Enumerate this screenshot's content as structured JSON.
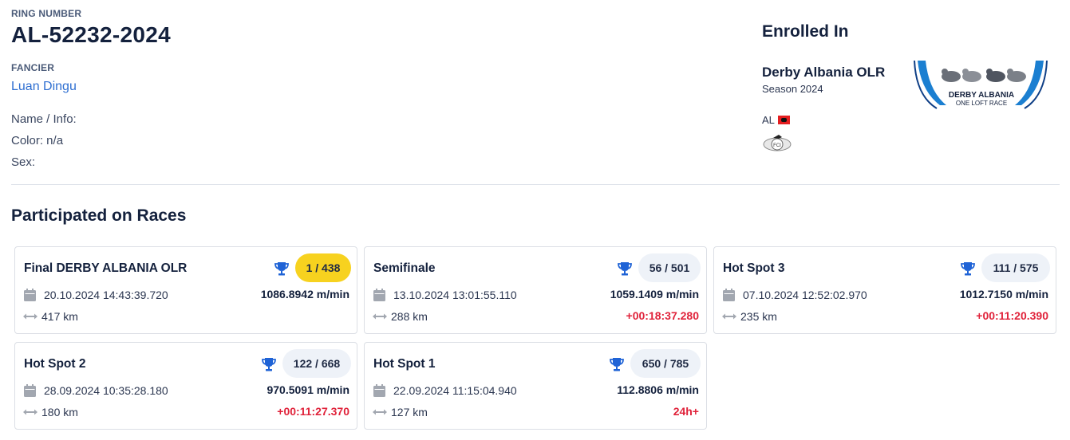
{
  "bird": {
    "ring_label": "RING NUMBER",
    "ring_number": "AL-52232-2024",
    "fancier_label": "FANCIER",
    "fancier_name": "Luan Dingu",
    "name_info": "Name / Info:",
    "color": "Color: n/a",
    "sex": "Sex:"
  },
  "enrollment": {
    "title": "Enrolled In",
    "competition": "Derby Albania OLR",
    "season": "Season 2024",
    "country": "AL",
    "logo_text_main": "DERBY ALBANIA",
    "logo_text_sub": "ONE LOFT RACE",
    "fci_logo_text": "FCI"
  },
  "races": {
    "title": "Participated on Races",
    "items": [
      {
        "name": "Final DERBY ALBANIA OLR",
        "rank": "1 / 438",
        "gold": true,
        "date": "20.10.2024 14:43:39.720",
        "speed": "1086.8942 m/min",
        "distance": "417 km",
        "delay": ""
      },
      {
        "name": "Semifinale",
        "rank": "56 / 501",
        "gold": false,
        "date": "13.10.2024 13:01:55.110",
        "speed": "1059.1409 m/min",
        "distance": "288 km",
        "delay": "+00:18:37.280"
      },
      {
        "name": "Hot Spot 3",
        "rank": "111 / 575",
        "gold": false,
        "date": "07.10.2024 12:52:02.970",
        "speed": "1012.7150 m/min",
        "distance": "235 km",
        "delay": "+00:11:20.390"
      },
      {
        "name": "Hot Spot 2",
        "rank": "122 / 668",
        "gold": false,
        "date": "28.09.2024 10:35:28.180",
        "speed": "970.5091 m/min",
        "distance": "180 km",
        "delay": "+00:11:27.370"
      },
      {
        "name": "Hot Spot 1",
        "rank": "650 / 785",
        "gold": false,
        "date": "22.09.2024 11:15:04.940",
        "speed": "112.8806 m/min",
        "distance": "127 km",
        "delay": "24h+"
      }
    ]
  },
  "colors": {
    "accent_blue": "#2f6fd1",
    "trophy_blue": "#1f63d6",
    "gold": "#f7d21f",
    "delay_red": "#e0223a",
    "text_dark": "#14213d"
  },
  "icons": {
    "trophy": "trophy-icon",
    "calendar": "calendar-icon",
    "distance": "distance-arrow-icon",
    "flag": "albania-flag-icon"
  }
}
